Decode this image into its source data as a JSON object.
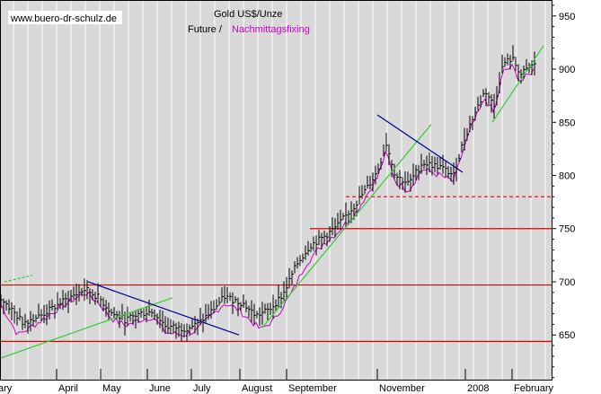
{
  "chart_data": {
    "type": "bar",
    "subtype": "ohlc",
    "header": {
      "website": "www.buero-dr-schulz.de",
      "title": "Gold US$/Unze",
      "subtitle_future": "Future /",
      "subtitle_fixing": "Nachmittagsfixing"
    },
    "y_axis": {
      "range": [
        608,
        965
      ],
      "ticks": [
        650,
        700,
        750,
        800,
        850,
        900,
        950
      ],
      "position": "right"
    },
    "x_axis": {
      "labels": [
        "ary",
        "April",
        "May",
        "June",
        "July",
        "August",
        "September",
        "November",
        "2008",
        "February"
      ]
    },
    "colors": {
      "background": "#d8d8d8",
      "bars": "#000000",
      "fixing": "#cc00cc",
      "support_resistance": "#e00000",
      "trend_up": "#33cc33",
      "trend_down": "#000099",
      "grid": "#ffffff",
      "header_pink": "#cc00cc"
    },
    "series": [
      {
        "name": "Future",
        "style": "ohlc",
        "color": "#000000",
        "anchors": [
          [
            0,
            686
          ],
          [
            25,
            662
          ],
          [
            45,
            668
          ],
          [
            60,
            676
          ],
          [
            75,
            684
          ],
          [
            95,
            693
          ],
          [
            110,
            685
          ],
          [
            125,
            670
          ],
          [
            140,
            664
          ],
          [
            155,
            670
          ],
          [
            170,
            672
          ],
          [
            185,
            658
          ],
          [
            205,
            656
          ],
          [
            220,
            660
          ],
          [
            235,
            672
          ],
          [
            250,
            686
          ],
          [
            270,
            680
          ],
          [
            285,
            668
          ],
          [
            300,
            674
          ],
          [
            315,
            688
          ],
          [
            330,
            716
          ],
          [
            345,
            734
          ],
          [
            360,
            742
          ],
          [
            375,
            752
          ],
          [
            395,
            772
          ],
          [
            410,
            790
          ],
          [
            420,
            804
          ],
          [
            430,
            830
          ],
          [
            440,
            800
          ],
          [
            455,
            792
          ],
          [
            470,
            812
          ],
          [
            490,
            808
          ],
          [
            505,
            800
          ],
          [
            515,
            830
          ],
          [
            525,
            852
          ],
          [
            540,
            880
          ],
          [
            550,
            865
          ],
          [
            560,
            905
          ],
          [
            570,
            910
          ],
          [
            580,
            895
          ],
          [
            595,
            905
          ]
        ]
      },
      {
        "name": "Nachmittagsfixing",
        "style": "line",
        "color": "#cc00cc",
        "anchors": [
          [
            0,
            680
          ],
          [
            20,
            650
          ],
          [
            45,
            663
          ],
          [
            60,
            672
          ],
          [
            75,
            680
          ],
          [
            95,
            690
          ],
          [
            110,
            680
          ],
          [
            125,
            665
          ],
          [
            140,
            659
          ],
          [
            155,
            664
          ],
          [
            170,
            667
          ],
          [
            185,
            652
          ],
          [
            205,
            650
          ],
          [
            220,
            655
          ],
          [
            235,
            668
          ],
          [
            250,
            680
          ],
          [
            265,
            674
          ],
          [
            290,
            655
          ],
          [
            305,
            664
          ],
          [
            325,
            690
          ],
          [
            340,
            716
          ],
          [
            350,
            726
          ],
          [
            360,
            736
          ],
          [
            375,
            746
          ],
          [
            395,
            764
          ],
          [
            410,
            784
          ],
          [
            420,
            798
          ],
          [
            430,
            822
          ],
          [
            440,
            794
          ],
          [
            455,
            786
          ],
          [
            470,
            806
          ],
          [
            490,
            800
          ],
          [
            505,
            794
          ],
          [
            515,
            822
          ],
          [
            525,
            846
          ],
          [
            540,
            872
          ],
          [
            550,
            858
          ],
          [
            560,
            898
          ],
          [
            570,
            902
          ],
          [
            580,
            888
          ],
          [
            595,
            900
          ]
        ]
      }
    ],
    "reference_lines": [
      {
        "kind": "horizontal",
        "y": 697,
        "x0": 0,
        "x1": 614,
        "color": "#e00000",
        "dashed": false
      },
      {
        "kind": "horizontal",
        "y": 644,
        "x0": 0,
        "x1": 614,
        "color": "#e00000",
        "dashed": false
      },
      {
        "kind": "horizontal",
        "y": 750,
        "x0": 345,
        "x1": 614,
        "color": "#e00000",
        "dashed": false
      },
      {
        "kind": "horizontal",
        "y": 780,
        "x0": 385,
        "x1": 614,
        "color": "#e00000",
        "dashed": true
      }
    ],
    "trend_lines": [
      {
        "from": [
          0,
          628
        ],
        "to": [
          192,
          685
        ],
        "color": "#33cc33",
        "dashed": false
      },
      {
        "from": [
          5,
          700
        ],
        "to": [
          36,
          706
        ],
        "color": "#33cc33",
        "dashed": true
      },
      {
        "from": [
          98,
          700
        ],
        "to": [
          266,
          650
        ],
        "color": "#000099",
        "dashed": false
      },
      {
        "from": [
          292,
          657
        ],
        "to": [
          480,
          848
        ],
        "color": "#33cc33",
        "dashed": false
      },
      {
        "from": [
          420,
          857
        ],
        "to": [
          515,
          803
        ],
        "color": "#000099",
        "dashed": false
      },
      {
        "from": [
          548,
          850
        ],
        "to": [
          605,
          922
        ],
        "color": "#33cc33",
        "dashed": false
      }
    ]
  }
}
